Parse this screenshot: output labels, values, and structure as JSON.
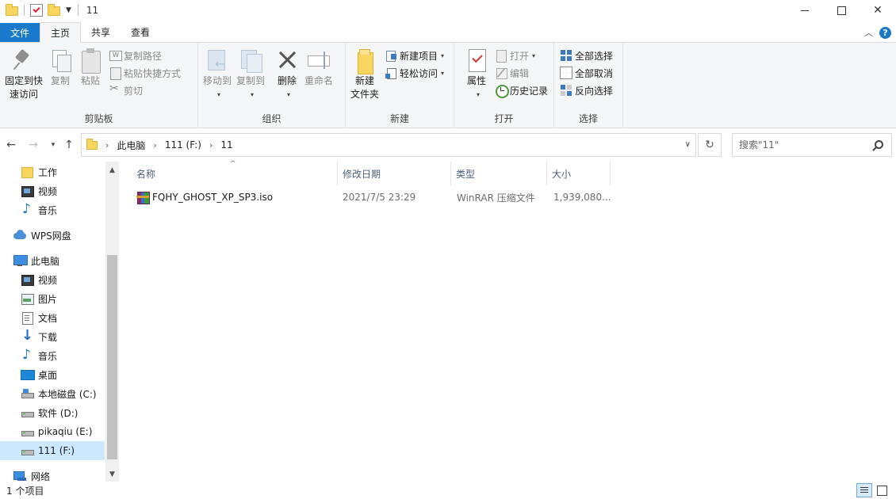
{
  "window": {
    "title": "11",
    "controls": {
      "minimize": "minimize",
      "maximize": "maximize",
      "close": "✕"
    }
  },
  "ribbon_tabs": {
    "file": "文件",
    "home": "主页",
    "share": "共享",
    "view": "查看"
  },
  "ribbon": {
    "clipboard": {
      "label": "剪贴板",
      "pin": "固定到快速访问",
      "pin_line1": "固定到快",
      "pin_line2": "速访问",
      "copy": "复制",
      "paste": "粘贴",
      "copy_path": "复制路径",
      "paste_shortcut": "粘贴快捷方式",
      "cut": "剪切"
    },
    "organize": {
      "label": "组织",
      "move_to": "移动到",
      "copy_to": "复制到",
      "delete": "删除",
      "rename": "重命名"
    },
    "new": {
      "label": "新建",
      "new_folder_line1": "新建",
      "new_folder_line2": "文件夹",
      "new_item": "新建项目",
      "easy_access": "轻松访问"
    },
    "open": {
      "label": "打开",
      "properties": "属性",
      "open": "打开",
      "edit": "编辑",
      "history": "历史记录"
    },
    "select": {
      "label": "选择",
      "select_all": "全部选择",
      "select_none": "全部取消",
      "invert": "反向选择"
    }
  },
  "address_bar": {
    "crumbs": [
      "此电脑",
      "111 (F:)",
      "11"
    ]
  },
  "search": {
    "placeholder": "搜索\"11\""
  },
  "nav_pane": {
    "items": [
      {
        "label": "工作",
        "icon": "folder-icon"
      },
      {
        "label": "视频",
        "icon": "video-icon"
      },
      {
        "label": "音乐",
        "icon": "music-icon"
      },
      {
        "label": "WPS网盘",
        "icon": "cloud-icon"
      },
      {
        "label": "此电脑",
        "icon": "computer-icon"
      },
      {
        "label": "视频",
        "icon": "video-icon"
      },
      {
        "label": "图片",
        "icon": "picture-icon"
      },
      {
        "label": "文档",
        "icon": "document-icon"
      },
      {
        "label": "下载",
        "icon": "download-icon"
      },
      {
        "label": "音乐",
        "icon": "music-icon"
      },
      {
        "label": "桌面",
        "icon": "desktop-icon"
      },
      {
        "label": "本地磁盘 (C:)",
        "icon": "system-drive-icon"
      },
      {
        "label": "软件 (D:)",
        "icon": "drive-icon"
      },
      {
        "label": "pikaqiu (E:)",
        "icon": "drive-icon"
      },
      {
        "label": "111 (F:)",
        "icon": "drive-icon",
        "selected": true
      },
      {
        "label": "网络",
        "icon": "network-icon"
      }
    ]
  },
  "columns": {
    "name": "名称",
    "modified": "修改日期",
    "type": "类型",
    "size": "大小"
  },
  "files": [
    {
      "name": "FQHY_GHOST_XP_SP3.iso",
      "modified": "2021/7/5 23:29",
      "type": "WinRAR 压缩文件",
      "size": "1,939,080..."
    }
  ],
  "status_bar": {
    "item_count": "1 个项目"
  }
}
